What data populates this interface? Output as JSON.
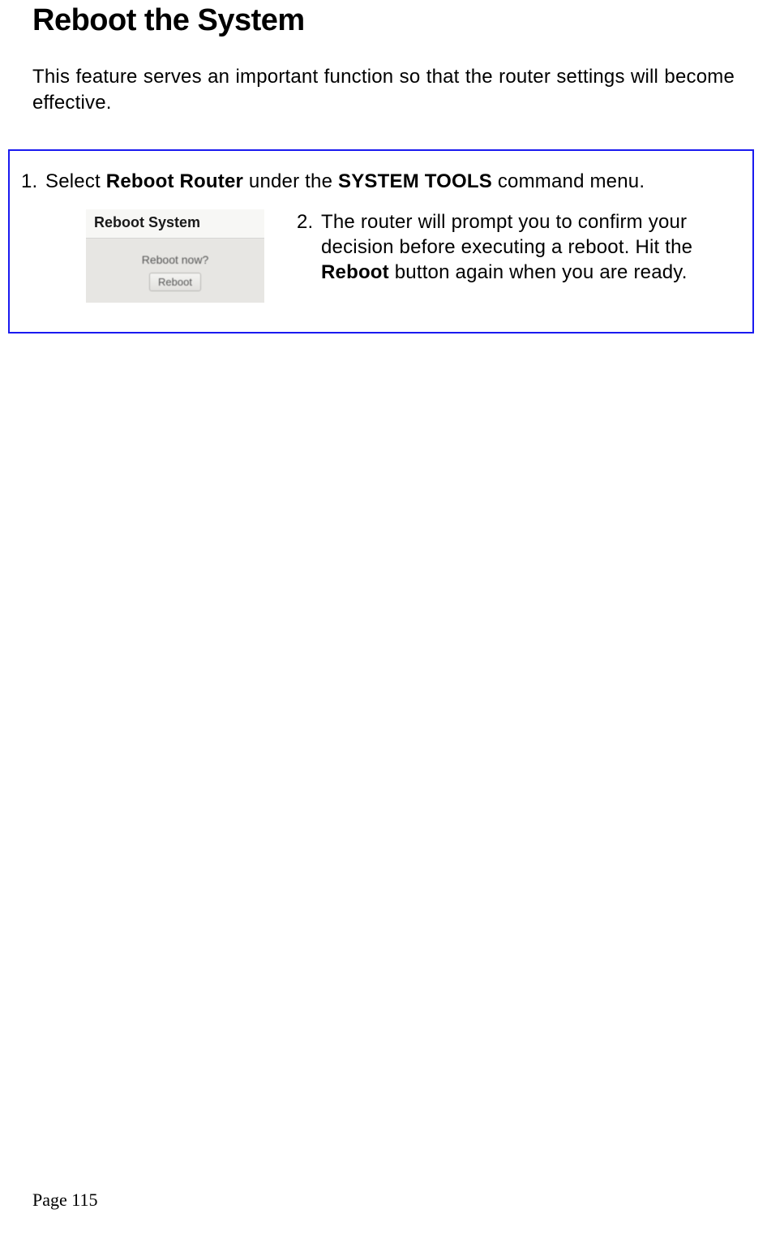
{
  "title": "Reboot the System",
  "intro": "This feature serves an important function so that the router settings will become effective.",
  "step1": {
    "num": "1.",
    "pre": "Select ",
    "bold1": "Reboot Router",
    "mid": " under the ",
    "bold2": "SYSTEM TOOLS",
    "post": " command menu."
  },
  "ui": {
    "header": "Reboot System",
    "question": "Reboot now?",
    "button": "Reboot"
  },
  "step2": {
    "num": "2.",
    "p1": "The router will prompt you to confirm your decision before executing a reboot. Hit the ",
    "bold": "Reboot",
    "p2": " button again when you are ready."
  },
  "footer": "Page 115"
}
